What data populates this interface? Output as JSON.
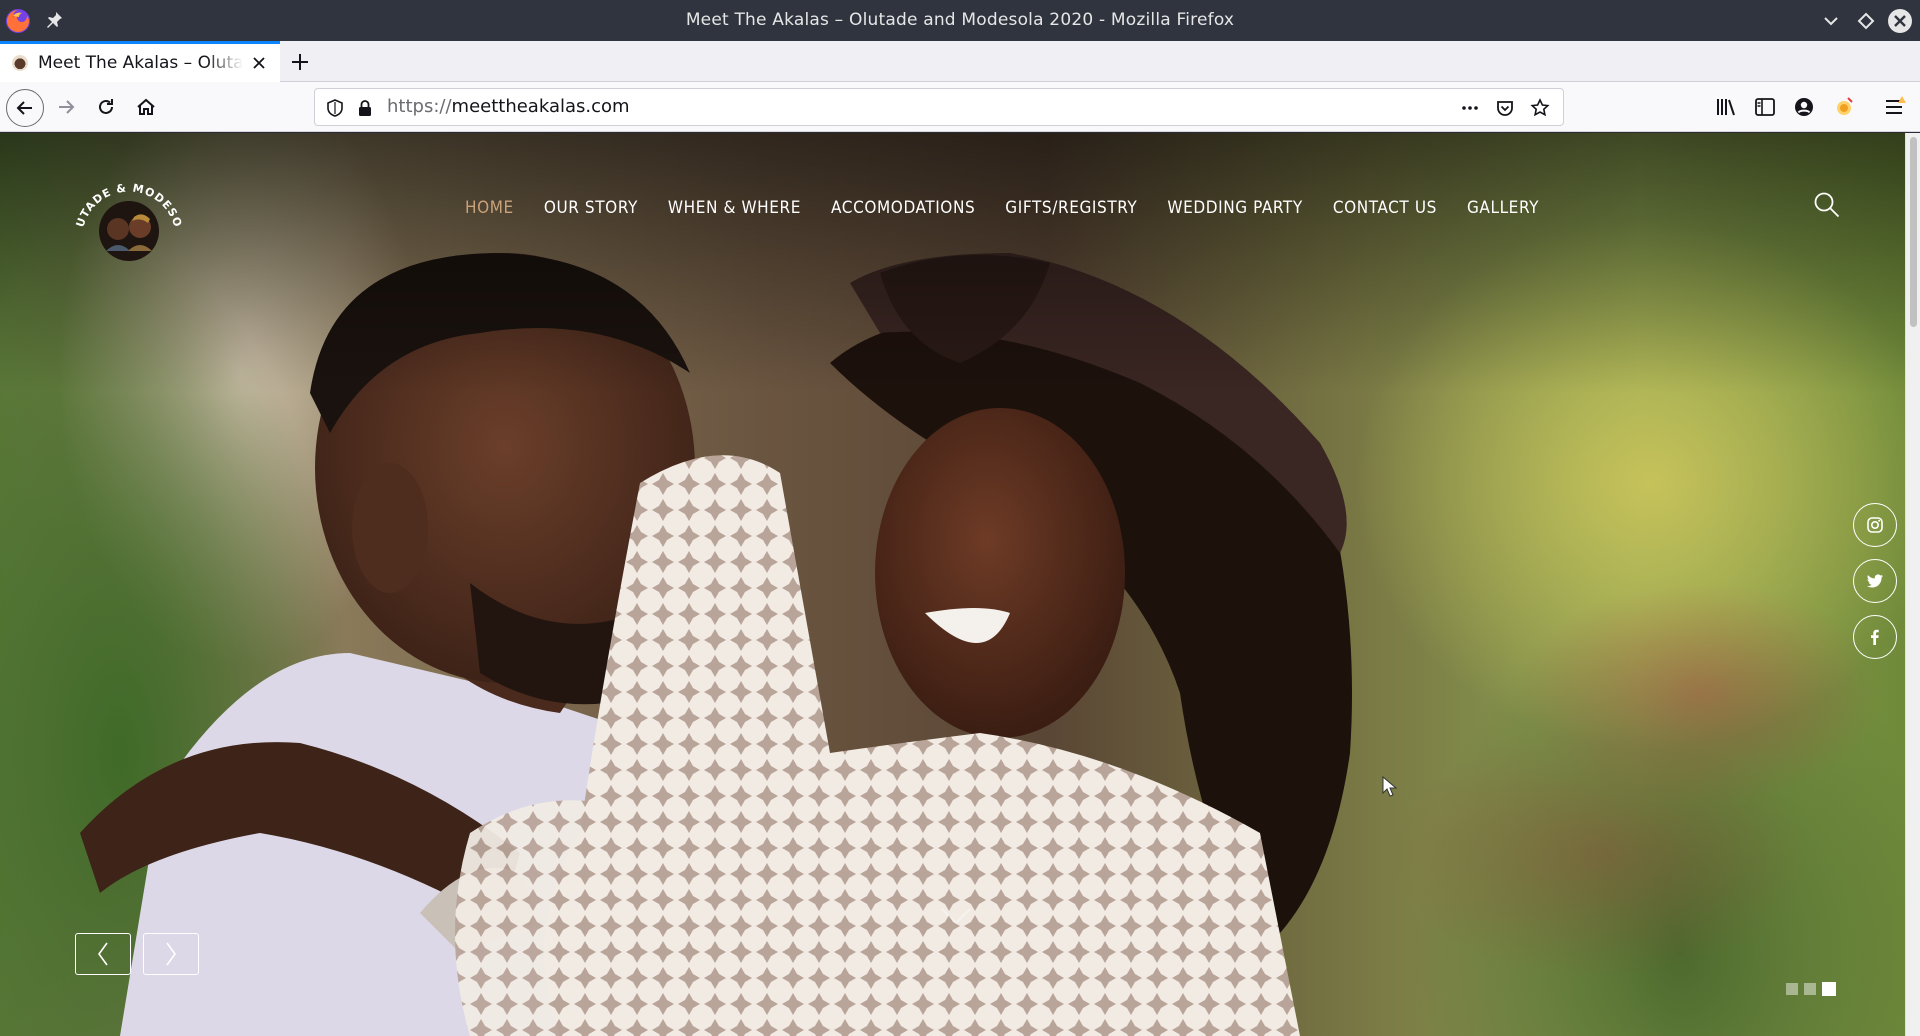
{
  "window": {
    "title": "Meet The Akalas – Olutade and Modesola 2020 - Mozilla Firefox"
  },
  "tabs": [
    {
      "label": "Meet The Akalas – Olutade and Modesola 2020",
      "active": true
    }
  ],
  "toolbar": {
    "url_scheme": "https://",
    "url_host": "meettheakalas.com"
  },
  "site": {
    "logo_text": "OLUTADE & MODESOLA",
    "nav": [
      {
        "label": "HOME",
        "active": true
      },
      {
        "label": "OUR STORY",
        "active": false
      },
      {
        "label": "WHEN & WHERE",
        "active": false
      },
      {
        "label": "ACCOMODATIONS",
        "active": false
      },
      {
        "label": "GIFTS/REGISTRY",
        "active": false
      },
      {
        "label": "WEDDING PARTY",
        "active": false
      },
      {
        "label": "CONTACT US",
        "active": false
      },
      {
        "label": "GALLERY",
        "active": false
      }
    ],
    "socials": [
      "instagram-icon",
      "twitter-icon",
      "facebook-icon"
    ],
    "slider": {
      "slide_count": 3,
      "active_slide": 3
    }
  },
  "colors": {
    "accent_nav_active": "#c9a27a",
    "titlebar_bg": "#2f343f",
    "tab_accent": "#0a84ff"
  }
}
